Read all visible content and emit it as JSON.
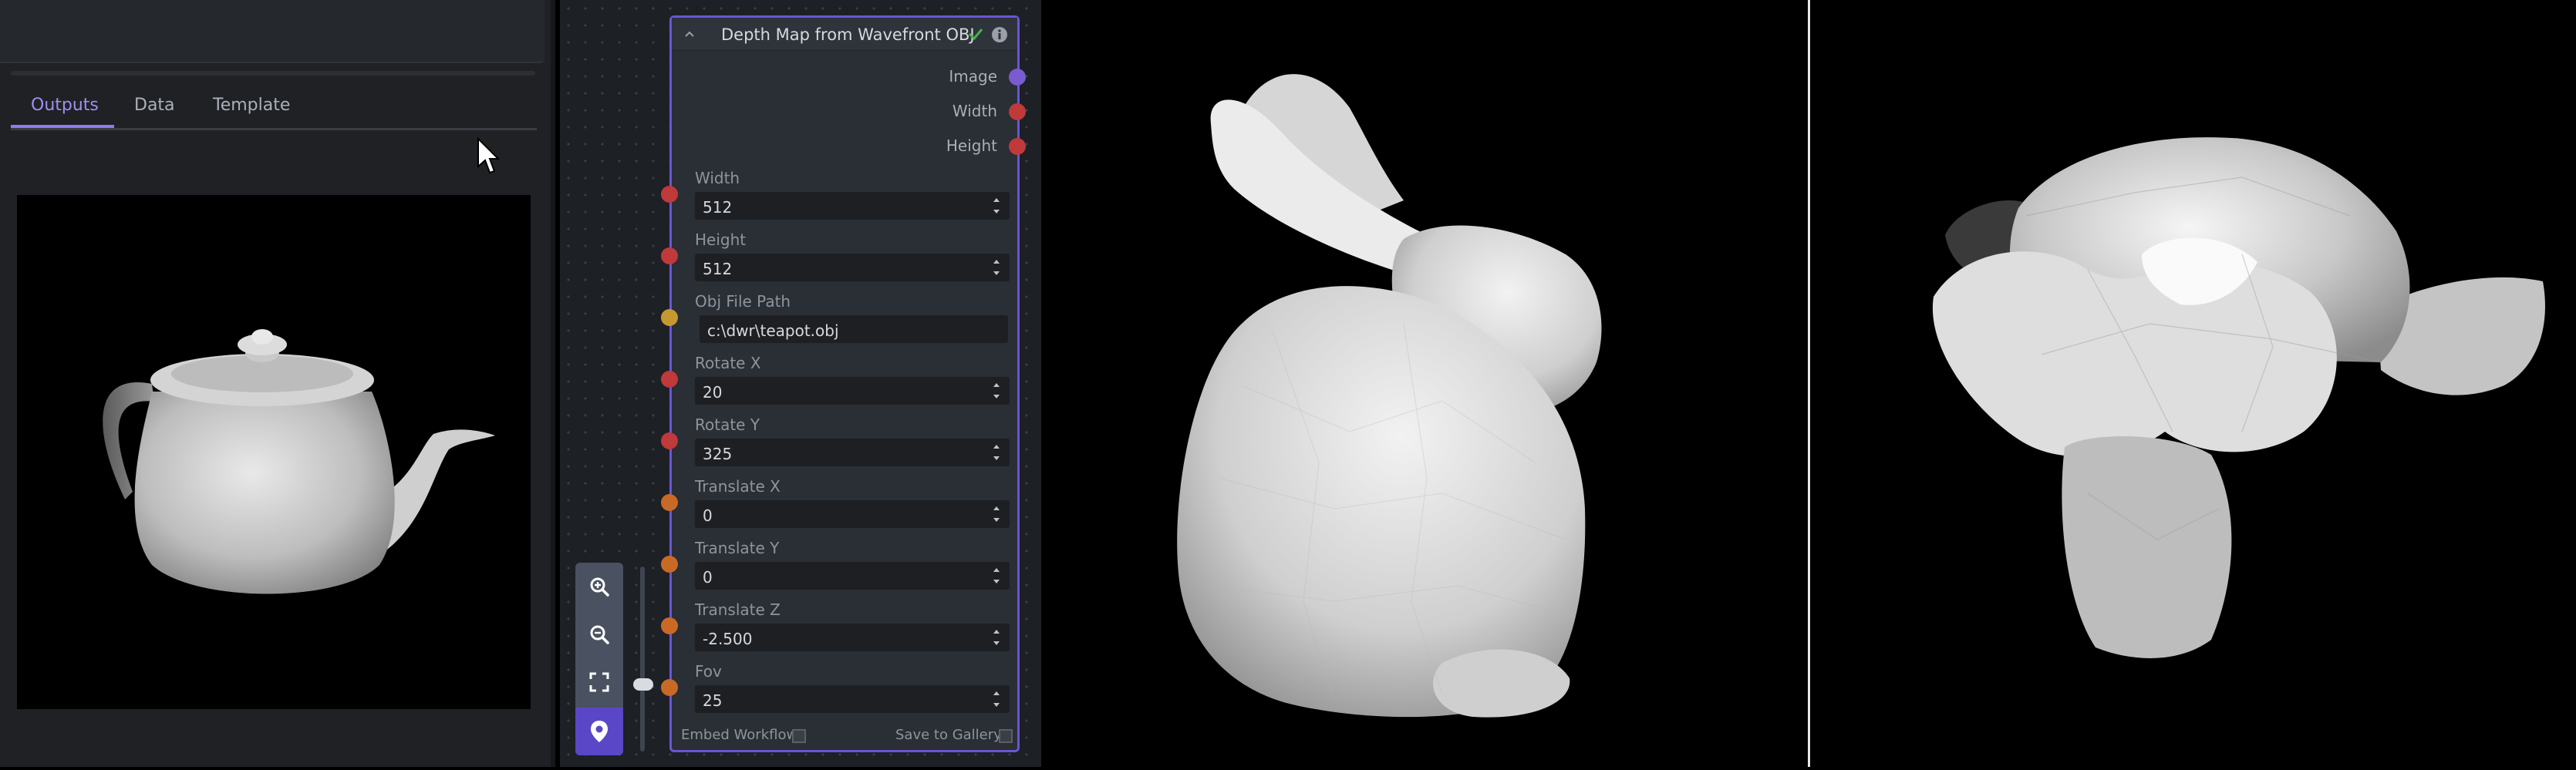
{
  "left_panel": {
    "tabs": [
      {
        "label": "Outputs",
        "active": true
      },
      {
        "label": "Data",
        "active": false
      },
      {
        "label": "Template",
        "active": false
      }
    ],
    "preview_subject": "teapot"
  },
  "toolbar": {
    "buttons": [
      "zoom-in-icon",
      "zoom-out-icon",
      "fit-view-icon",
      "locate-icon"
    ]
  },
  "node": {
    "title": "Depth Map from Wavefront OBJ",
    "outputs": [
      {
        "label": "Image",
        "color": "#7a5bd0"
      },
      {
        "label": "Width",
        "color": "#c0393b"
      },
      {
        "label": "Height",
        "color": "#c0393b"
      }
    ],
    "fields": [
      {
        "label": "Width",
        "value": "512",
        "type": "number",
        "color": "#c0393b"
      },
      {
        "label": "Height",
        "value": "512",
        "type": "number",
        "color": "#c0393b"
      },
      {
        "label": "Obj File Path",
        "value": "c:\\dwr\\teapot.obj",
        "type": "text",
        "color": "#c49a30"
      },
      {
        "label": "Rotate X",
        "value": "20",
        "type": "number",
        "color": "#c0393b"
      },
      {
        "label": "Rotate Y",
        "value": "325",
        "type": "number",
        "color": "#c0393b"
      },
      {
        "label": "Translate X",
        "value": "0",
        "type": "number",
        "color": "#c86a26"
      },
      {
        "label": "Translate Y",
        "value": "0",
        "type": "number",
        "color": "#c86a26"
      },
      {
        "label": "Translate Z",
        "value": "-2.500",
        "type": "number",
        "color": "#c86a26"
      },
      {
        "label": "Fov",
        "value": "25",
        "type": "number",
        "color": "#c86a26"
      }
    ],
    "embed_workflow_label": "Embed Workflow",
    "save_to_gallery_label": "Save to Gallery",
    "status_color": "#4caf50"
  },
  "views": {
    "middle_subject": "bunny",
    "right_subject": "monkey head"
  }
}
